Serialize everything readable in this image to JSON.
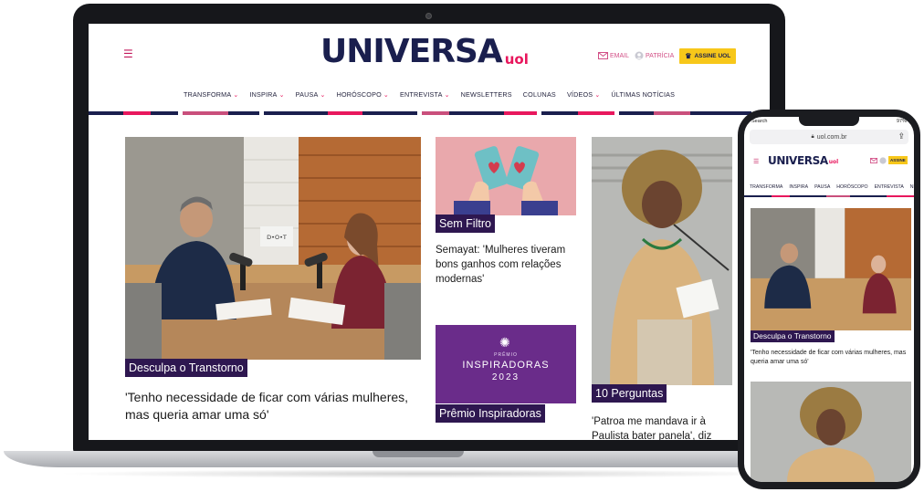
{
  "site": {
    "logo": "UNIVERSA",
    "logo_suffix": "uol",
    "email_label": "EMAIL",
    "user_label": "PATRÍCIA",
    "subscribe_label": "ASSINE UOL"
  },
  "nav": [
    {
      "label": "TRANSFORMA",
      "dropdown": true
    },
    {
      "label": "INSPIRA",
      "dropdown": true
    },
    {
      "label": "PAUSA",
      "dropdown": true
    },
    {
      "label": "HORÓSCOPO",
      "dropdown": true
    },
    {
      "label": "ENTREVISTA",
      "dropdown": true
    },
    {
      "label": "NEWSLETTERS",
      "dropdown": false
    },
    {
      "label": "COLUNAS",
      "dropdown": false
    },
    {
      "label": "VÍDEOS",
      "dropdown": true
    },
    {
      "label": "ÚLTIMAS NOTÍCIAS",
      "dropdown": false
    }
  ],
  "cards": {
    "main": {
      "badge": "Desculpa o Transtorno",
      "headline_line1": "'Tenho necessidade de ficar com várias mulheres,",
      "headline_line2": "mas queria amar uma só'",
      "sign_text": "D•O•T"
    },
    "semfiltro": {
      "badge": "Sem Filtro",
      "headline_line1": "Semayat: 'Mulheres tiveram",
      "headline_line2": "bons ganhos com relações",
      "headline_line3": "modernas'"
    },
    "inspiradoras": {
      "badge": "Prêmio Inspiradoras",
      "art_small": "PRÊMIO",
      "art_title": "INSPIRADORAS",
      "art_year": "2023"
    },
    "perguntas": {
      "badge": "10 Perguntas",
      "headline_line1": "'Patroa me mandava ir à",
      "headline_line2": "Paulista bater panela', diz"
    }
  },
  "phone": {
    "status_left": "Search",
    "status_right": "97%",
    "url": "uol.com.br",
    "subscribe_label": "ASSINE",
    "nav": [
      "TRANSFORMA",
      "INSPIRA",
      "PAUSA",
      "HORÓSCOPO",
      "ENTREVISTA",
      "NE"
    ],
    "badge": "Desculpa o Transtorno",
    "headline": "'Tenho necessidade de ficar com várias mulheres, mas queria amar uma só'"
  },
  "colors": {
    "navy": "#1a1f4e",
    "pink": "#e8175d",
    "purple": "#2e1750",
    "yellow": "#f7c71a"
  }
}
